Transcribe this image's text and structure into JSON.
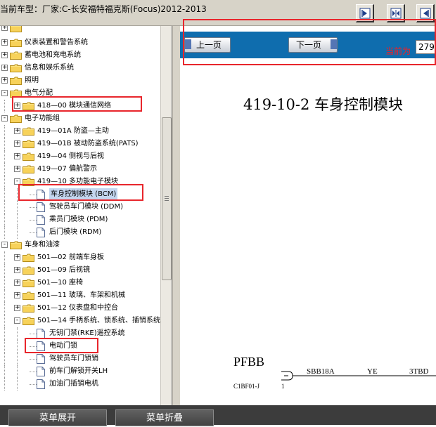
{
  "header": {
    "car_model_label": "当前车型：厂家:C-长安福特福克斯(Focus)2012-2013",
    "toolbar_icons": [
      "step-forward-icon",
      "expand-pages-icon",
      "step-back-icon"
    ]
  },
  "tree": {
    "items": [
      {
        "label": "仪表装置和警告系统",
        "level": 0,
        "type": "folder",
        "expander": "+"
      },
      {
        "label": "蓄电池和充电系统",
        "level": 0,
        "type": "folder",
        "expander": "+"
      },
      {
        "label": "信息和娱乐系统",
        "level": 0,
        "type": "folder",
        "expander": "+"
      },
      {
        "label": "照明",
        "level": 0,
        "type": "folder",
        "expander": "+"
      },
      {
        "label": "电气分配",
        "level": 0,
        "type": "folder",
        "expander": "-"
      },
      {
        "label": "418—00 模块通信网络",
        "level": 1,
        "type": "folder",
        "expander": "+"
      },
      {
        "label": "电子功能组",
        "level": 0,
        "type": "folder",
        "expander": "-"
      },
      {
        "label": "419—01A 防盗—主动",
        "level": 1,
        "type": "folder",
        "expander": "+"
      },
      {
        "label": "419—01B 被动防盗系统(PATS)",
        "level": 1,
        "type": "folder",
        "expander": "+"
      },
      {
        "label": "419—04 侧视与后视",
        "level": 1,
        "type": "folder",
        "expander": "+"
      },
      {
        "label": "419—07 偏航警示",
        "level": 1,
        "type": "folder",
        "expander": "+"
      },
      {
        "label": "419—10 多功能电子模块",
        "level": 1,
        "type": "folder",
        "expander": "-"
      },
      {
        "label": "车身控制模块 (BCM)",
        "level": 2,
        "type": "doc",
        "selected": true
      },
      {
        "label": "驾驶员车门模块 (DDM)",
        "level": 2,
        "type": "doc"
      },
      {
        "label": "乘员门模块 (PDM)",
        "level": 2,
        "type": "doc"
      },
      {
        "label": "后门模块 (RDM)",
        "level": 2,
        "type": "doc"
      },
      {
        "label": "车身和油漆",
        "level": 0,
        "type": "folder",
        "expander": "-"
      },
      {
        "label": "501—02 前端车身板",
        "level": 1,
        "type": "folder",
        "expander": "+"
      },
      {
        "label": "501—09 后视镜",
        "level": 1,
        "type": "folder",
        "expander": "+"
      },
      {
        "label": "501—10 座椅",
        "level": 1,
        "type": "folder",
        "expander": "+"
      },
      {
        "label": "501—11 玻璃、车架和机械",
        "level": 1,
        "type": "folder",
        "expander": "+"
      },
      {
        "label": "501—12 仪表盘和中控台",
        "level": 1,
        "type": "folder",
        "expander": "+"
      },
      {
        "label": "501—14 手柄系统、锁系统、插销系统",
        "level": 1,
        "type": "folder",
        "expander": "-"
      },
      {
        "label": "无钥门禁(RKE)遥控系统",
        "level": 2,
        "type": "doc"
      },
      {
        "label": "电动门锁",
        "level": 2,
        "type": "doc"
      },
      {
        "label": "驾驶员车门锁销",
        "level": 2,
        "type": "doc"
      },
      {
        "label": "前车门解锁开关LH",
        "level": 2,
        "type": "doc"
      },
      {
        "label": "加油门插销电机",
        "level": 2,
        "type": "doc"
      }
    ]
  },
  "navigation": {
    "prev_label": "上一页",
    "next_label": "下一页",
    "current_label": "当前为",
    "current_page": "279"
  },
  "document": {
    "title": "419-10-2 车身控制模块",
    "connector_name": "PFBB",
    "connector_id": "C1BF01-J",
    "pin": "1",
    "circuit": "SBB18A",
    "wire_color": "YE",
    "destination": "3TBD"
  },
  "footer": {
    "expand_label": "菜单展开",
    "collapse_label": "菜单折叠"
  },
  "colors": {
    "nav_strip": "#0f6dae",
    "highlight": "#e8262c",
    "current_label": "#ff1a1a",
    "selected_item": "#c4d6ef"
  }
}
